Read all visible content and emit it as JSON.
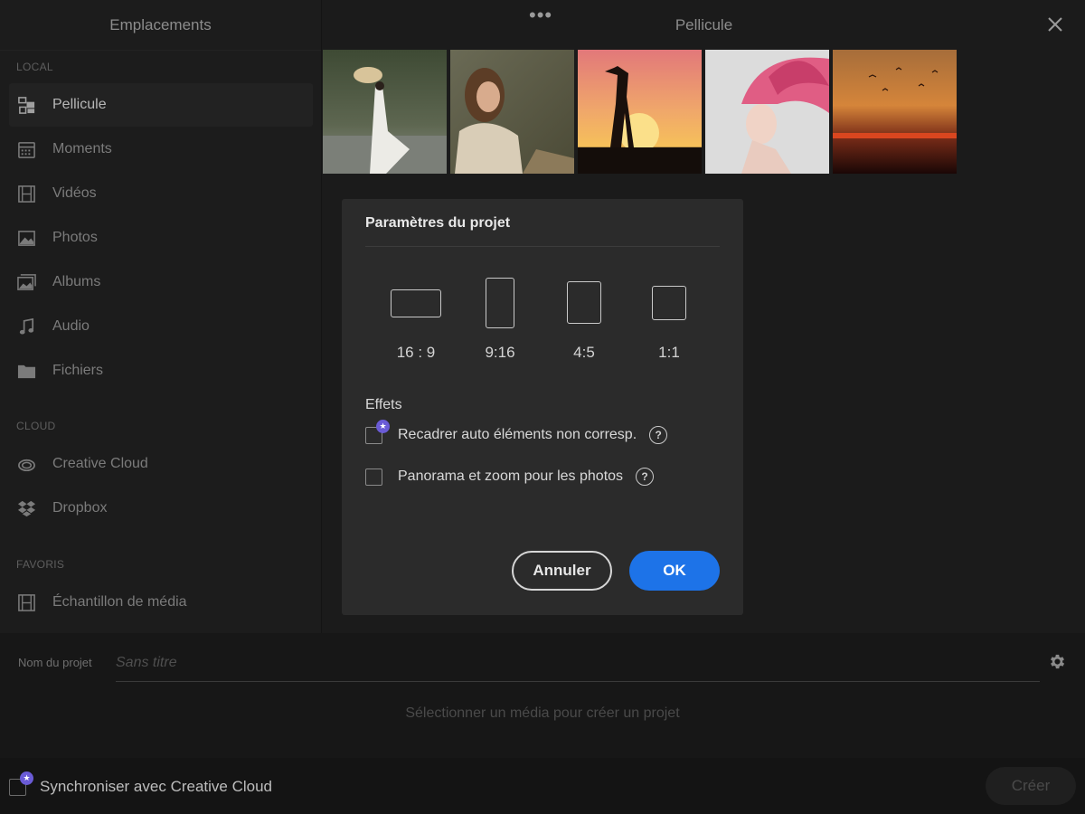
{
  "sidebar": {
    "title": "Emplacements",
    "sections": {
      "local": "LOCAL",
      "cloud": "CLOUD",
      "favorites": "FAVORIS"
    },
    "items": [
      {
        "label": "Pellicule",
        "icon": "camera-roll-icon",
        "active": true
      },
      {
        "label": "Moments",
        "icon": "calendar-icon"
      },
      {
        "label": "Vidéos",
        "icon": "film-icon"
      },
      {
        "label": "Photos",
        "icon": "image-icon"
      },
      {
        "label": "Albums",
        "icon": "albums-icon"
      },
      {
        "label": "Audio",
        "icon": "music-note-icon"
      },
      {
        "label": "Fichiers",
        "icon": "folder-icon"
      },
      {
        "label": "Creative Cloud",
        "icon": "creative-cloud-icon"
      },
      {
        "label": "Dropbox",
        "icon": "dropbox-icon"
      },
      {
        "label": "Échantillon de média",
        "icon": "film-icon"
      }
    ]
  },
  "header": {
    "title": "Pellicule",
    "more_icon": "more-dots-icon",
    "close_icon": "close-icon"
  },
  "dialog": {
    "title": "Paramètres du projet",
    "ratios": [
      "16 : 9",
      "9:16",
      "4:5",
      "1:1"
    ],
    "effects_label": "Effets",
    "options": [
      {
        "label": "Recadrer auto éléments non corresp.",
        "checked": false,
        "premium": true
      },
      {
        "label": "Panorama et zoom pour les photos",
        "checked": false,
        "premium": false
      }
    ],
    "help_symbol": "?",
    "premium_symbol": "★",
    "cancel_label": "Annuler",
    "ok_label": "OK"
  },
  "project": {
    "name_label": "Nom du projet",
    "name_placeholder": "Sans titre",
    "hint": "Sélectionner un média pour créer un projet",
    "settings_icon": "gear-icon"
  },
  "footer": {
    "sync_label": "Synchroniser avec Creative Cloud",
    "create_label": "Créer"
  },
  "colors": {
    "accent": "#1d73e8",
    "premium": "#6a5bd6",
    "background": "#1b1b1b"
  }
}
